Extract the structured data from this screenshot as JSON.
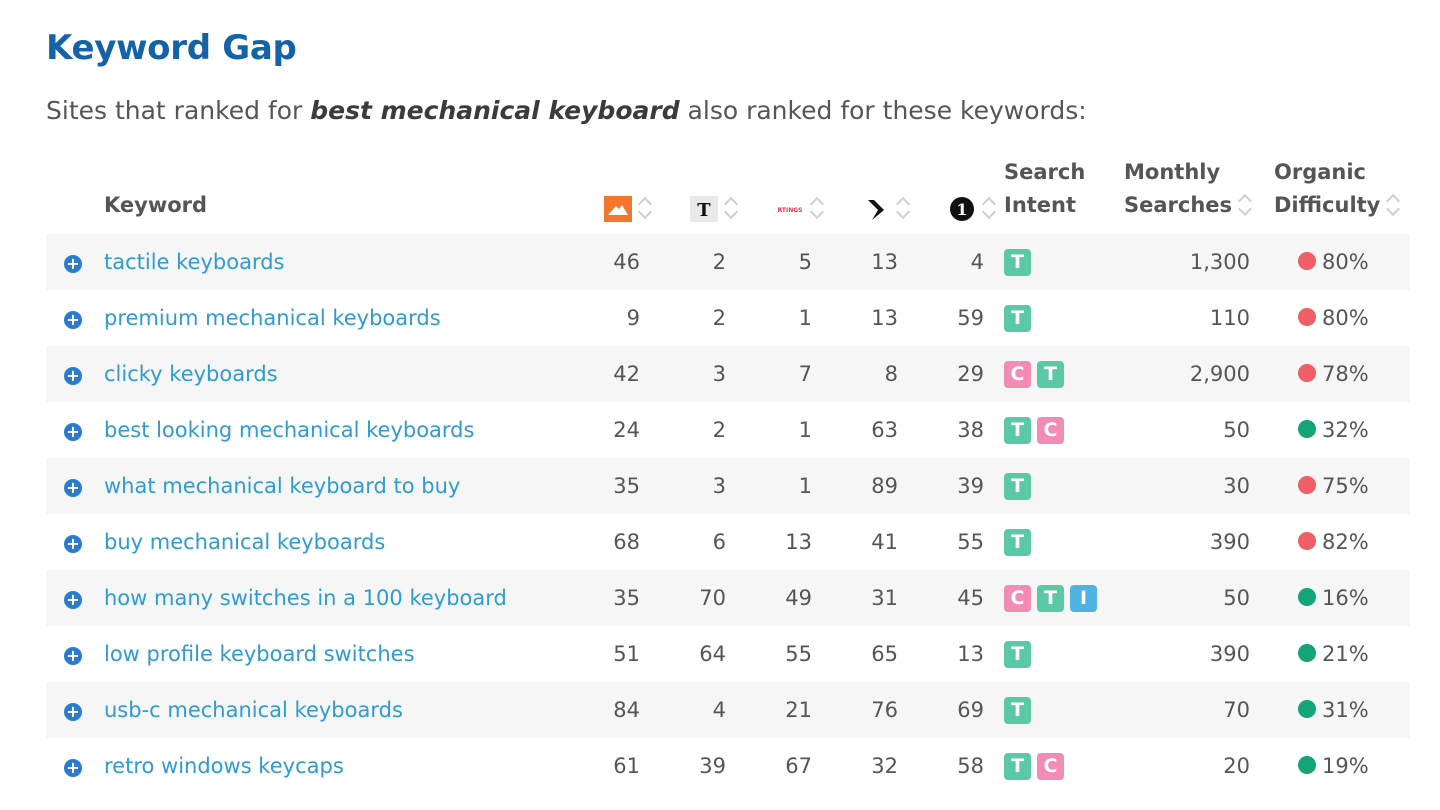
{
  "page": {
    "title": "Keyword Gap",
    "subtitle_prefix": "Sites that ranked for ",
    "subtitle_keyword": "best mechanical keyboard",
    "subtitle_suffix": " also ranked for these keywords:"
  },
  "colors": {
    "title": "#1463a8",
    "link": "#2f9ad6",
    "intent_transactional": "#5bc9a6",
    "intent_commercial": "#f38bb4",
    "intent_informational": "#4fb2e0",
    "difficulty_hard": "#f05f65",
    "difficulty_easy": "#13a478"
  },
  "columns": {
    "keyword": "Keyword",
    "search_intent_line1": "Search",
    "search_intent_line2": "Intent",
    "monthly_line1": "Monthly",
    "monthly_line2": "Searches",
    "organic_line1": "Organic",
    "organic_line2": "Difficulty"
  },
  "sites": [
    {
      "icon": "orange-mountain-logo-icon",
      "text": ""
    },
    {
      "icon": "nyt-logo-icon",
      "text": "T"
    },
    {
      "icon": "rtings-logo-icon",
      "text": "RTINGS"
    },
    {
      "icon": "verge-logo-icon",
      "text": ""
    },
    {
      "icon": "circle-one-logo-icon",
      "text": "1"
    }
  ],
  "rows": [
    {
      "keyword": "tactile keyboards",
      "ranks": [
        "46",
        "2",
        "5",
        "13",
        "4"
      ],
      "intent": [
        "T"
      ],
      "searches": "1,300",
      "difficulty": "80%",
      "level": "hard"
    },
    {
      "keyword": "premium mechanical keyboards",
      "ranks": [
        "9",
        "2",
        "1",
        "13",
        "59"
      ],
      "intent": [
        "T"
      ],
      "searches": "110",
      "difficulty": "80%",
      "level": "hard"
    },
    {
      "keyword": "clicky keyboards",
      "ranks": [
        "42",
        "3",
        "7",
        "8",
        "29"
      ],
      "intent": [
        "C",
        "T"
      ],
      "searches": "2,900",
      "difficulty": "78%",
      "level": "hard"
    },
    {
      "keyword": "best looking mechanical keyboards",
      "ranks": [
        "24",
        "2",
        "1",
        "63",
        "38"
      ],
      "intent": [
        "T",
        "C"
      ],
      "searches": "50",
      "difficulty": "32%",
      "level": "easy"
    },
    {
      "keyword": "what mechanical keyboard to buy",
      "ranks": [
        "35",
        "3",
        "1",
        "89",
        "39"
      ],
      "intent": [
        "T"
      ],
      "searches": "30",
      "difficulty": "75%",
      "level": "hard"
    },
    {
      "keyword": "buy mechanical keyboards",
      "ranks": [
        "68",
        "6",
        "13",
        "41",
        "55"
      ],
      "intent": [
        "T"
      ],
      "searches": "390",
      "difficulty": "82%",
      "level": "hard"
    },
    {
      "keyword": "how many switches in a 100 keyboard",
      "ranks": [
        "35",
        "70",
        "49",
        "31",
        "45"
      ],
      "intent": [
        "C",
        "T",
        "I"
      ],
      "searches": "50",
      "difficulty": "16%",
      "level": "easy"
    },
    {
      "keyword": "low profile keyboard switches",
      "ranks": [
        "51",
        "64",
        "55",
        "65",
        "13"
      ],
      "intent": [
        "T"
      ],
      "searches": "390",
      "difficulty": "21%",
      "level": "easy"
    },
    {
      "keyword": "usb-c mechanical keyboards",
      "ranks": [
        "84",
        "4",
        "21",
        "76",
        "69"
      ],
      "intent": [
        "T"
      ],
      "searches": "70",
      "difficulty": "31%",
      "level": "easy"
    },
    {
      "keyword": "retro windows keycaps",
      "ranks": [
        "61",
        "39",
        "67",
        "32",
        "58"
      ],
      "intent": [
        "T",
        "C"
      ],
      "searches": "20",
      "difficulty": "19%",
      "level": "easy"
    }
  ]
}
